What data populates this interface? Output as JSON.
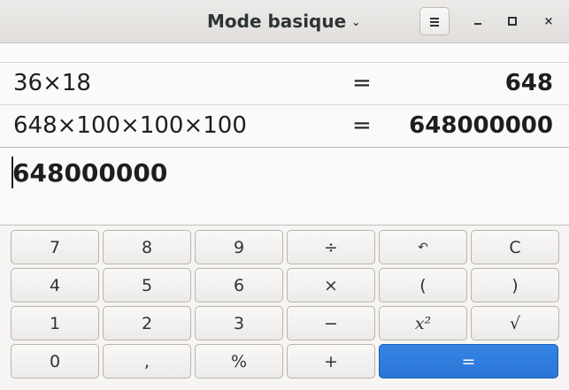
{
  "header": {
    "title": "Mode basique",
    "chevron_icon": "chevron-down-icon",
    "menu_icon": "hamburger-menu-icon",
    "controls": {
      "minimize_icon": "minimize-icon",
      "maximize_icon": "maximize-icon",
      "close_glyph": "×"
    }
  },
  "history": [
    {
      "expression": "36×18",
      "equals": "=",
      "result": "648"
    },
    {
      "expression": "648×100×100×100",
      "equals": "=",
      "result": "648000000"
    }
  ],
  "input": {
    "value": "648000000"
  },
  "keypad": {
    "rows": [
      [
        "7",
        "8",
        "9",
        "÷",
        "↶",
        "C"
      ],
      [
        "4",
        "5",
        "6",
        "×",
        "(",
        ")"
      ],
      [
        "1",
        "2",
        "3",
        "−",
        "x²",
        "√"
      ],
      [
        "0",
        ",",
        "%",
        "+",
        "="
      ]
    ]
  },
  "colors": {
    "accent": "#3584e4",
    "headerbar": "#e6e3e0",
    "background": "#fafafa"
  }
}
